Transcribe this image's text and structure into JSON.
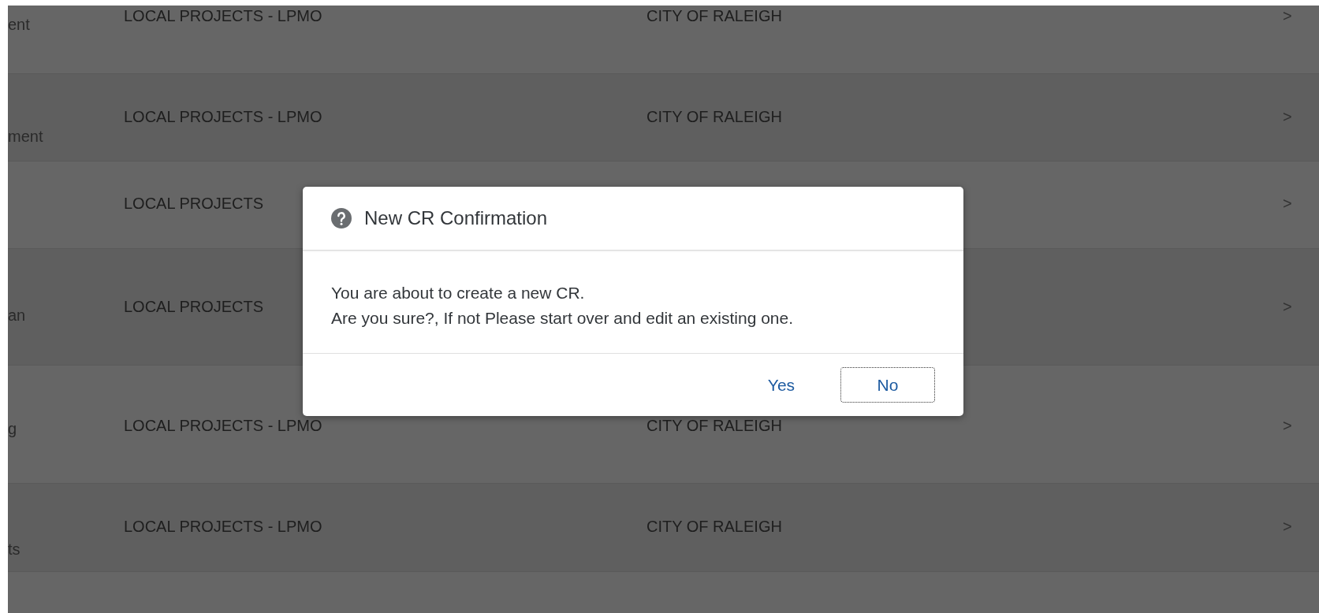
{
  "rows": [
    {
      "column_1": "ent",
      "project": "LOCAL PROJECTS - LPMO",
      "city": "CITY OF RALEIGH",
      "chevron": ">"
    },
    {
      "column_1": "ment",
      "project": "LOCAL PROJECTS - LPMO",
      "city": "CITY OF RALEIGH",
      "chevron": ">"
    },
    {
      "project": "LOCAL PROJECTS",
      "chevron": ">"
    },
    {
      "column_1": "an",
      "project": "LOCAL PROJECTS",
      "chevron": ">"
    },
    {
      "column_1": "g",
      "project": "LOCAL PROJECTS - LPMO",
      "city": "CITY OF RALEIGH",
      "chevron": ">"
    },
    {
      "column_1": "ts",
      "project": "LOCAL PROJECTS - LPMO",
      "city": "CITY OF RALEIGH",
      "chevron": ">"
    }
  ],
  "dialog": {
    "title": "New CR Confirmation",
    "message": [
      "You are about to create a new CR.",
      "Are you sure?, If not Please start over and edit an existing one."
    ],
    "buttons": [
      {
        "label": "Yes",
        "focused": false
      },
      {
        "label": "No",
        "focused": true
      }
    ]
  }
}
